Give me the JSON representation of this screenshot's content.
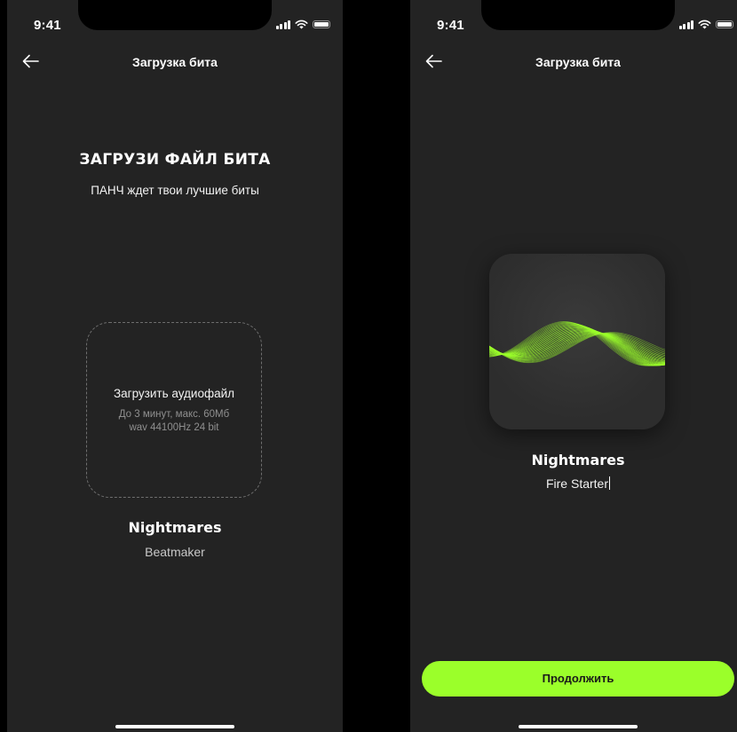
{
  "status_bar": {
    "time": "9:41"
  },
  "screens": {
    "upload": {
      "nav_title": "Загрузка бита",
      "headline": "ЗАГРУЗИ ФАЙЛ БИТА",
      "subheadline": "ПАНЧ ждет твои лучшие биты",
      "upload_box": {
        "title": "Загрузить аудиофайл",
        "hint_line1": "До 3 минут, макс. 60Мб",
        "hint_line2": "wav 44100Hz 24 bit"
      },
      "artist_name": "Nightmares",
      "beat_title_placeholder": "Beatmaker"
    },
    "uploaded": {
      "nav_title": "Загрузка бита",
      "artist_name": "Nightmares",
      "beat_title": "Fire Starter",
      "continue_label": "Продолжить"
    }
  },
  "colors": {
    "background": "#232323",
    "accent": "#9bff2a",
    "placeholder_text": "#c8c8c8"
  },
  "icons": {
    "back": "arrow-left-icon",
    "signal": "cellular-signal-icon",
    "wifi": "wifi-icon",
    "battery": "battery-icon",
    "cover": "sound-wave-artwork"
  }
}
